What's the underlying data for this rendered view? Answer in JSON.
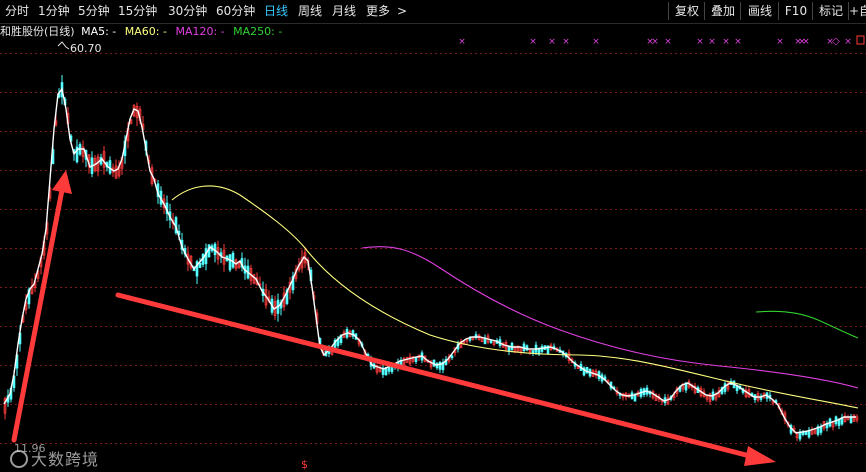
{
  "toolbar": {
    "periods": [
      {
        "label": "分时",
        "name": "period-intraday",
        "x": 5
      },
      {
        "label": "1分钟",
        "name": "period-1min",
        "x": 38
      },
      {
        "label": "5分钟",
        "name": "period-5min",
        "x": 78
      },
      {
        "label": "15分钟",
        "name": "period-15min",
        "x": 118
      },
      {
        "label": "30分钟",
        "name": "period-30min",
        "x": 168
      },
      {
        "label": "60分钟",
        "name": "period-60min",
        "x": 216
      },
      {
        "label": "日线",
        "name": "period-daily",
        "x": 264,
        "active": true
      },
      {
        "label": "周线",
        "name": "period-weekly",
        "x": 298
      },
      {
        "label": "月线",
        "name": "period-monthly",
        "x": 332
      },
      {
        "label": "更多",
        "name": "period-more",
        "x": 366
      }
    ],
    "more_arrow": ">",
    "buttons": [
      {
        "label": "复权",
        "name": "restore-rights-button"
      },
      {
        "label": "叠加",
        "name": "overlay-button"
      },
      {
        "label": "画线",
        "name": "draw-line-button"
      },
      {
        "label": "F10",
        "name": "f10-button"
      },
      {
        "label": "标记",
        "name": "mark-button"
      },
      {
        "label": "+自",
        "name": "add-watchlist-button"
      }
    ]
  },
  "legend": {
    "title": "和胜股份(日线)",
    "ma5": "MA5: -",
    "ma60": "MA60: -",
    "ma120": "MA120: -",
    "ma250": "MA250: -"
  },
  "annotations": {
    "high_price": "60.70",
    "low_price": "11.96",
    "event_marker": "$"
  },
  "watermark": "大数跨境",
  "colors": {
    "background": "#000000",
    "up_candle": "#ff3c3c",
    "down_candle": "#54ffff",
    "ma5": "#ffffff",
    "ma60": "#ffff80",
    "ma120": "#e040e0",
    "ma250": "#30d030",
    "grid": "#7a1a1a",
    "arrow": "#ff3a3a",
    "active_period": "#38c8ff"
  },
  "chart_data": {
    "type": "candlestick",
    "price_high": 60.7,
    "price_low": 11.96,
    "series": [
      {
        "name": "MA5",
        "color": "#ffffff"
      },
      {
        "name": "MA60",
        "color": "#ffff80"
      },
      {
        "name": "MA120",
        "color": "#e040e0"
      },
      {
        "name": "MA250",
        "color": "#30d030"
      }
    ]
  }
}
